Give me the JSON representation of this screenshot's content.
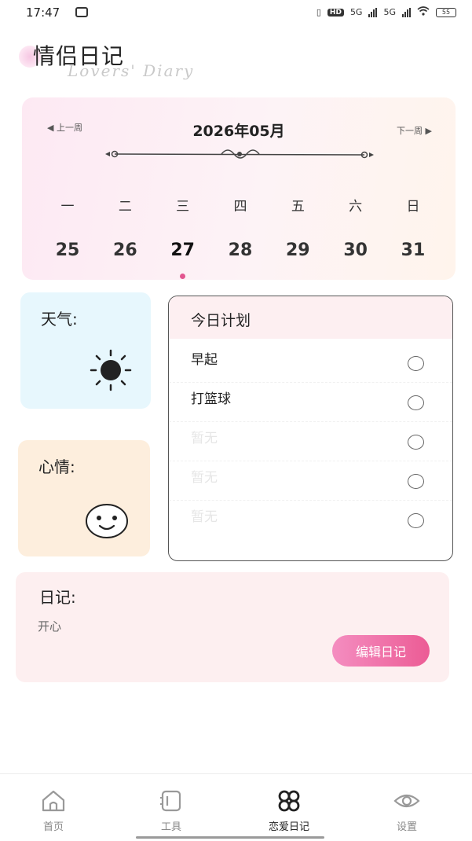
{
  "status_bar": {
    "time": "17:47",
    "hd": "HD",
    "signal_1": "5G",
    "signal_2": "5G",
    "battery": "55"
  },
  "header": {
    "title": "情侣日记",
    "subtitle": "Lovers' Diary"
  },
  "calendar": {
    "prev_label": "◀ 上一周",
    "next_label": "下一周 ▶",
    "month": "2026年05月",
    "weekdays": [
      "一",
      "二",
      "三",
      "四",
      "五",
      "六",
      "日"
    ],
    "dates": [
      "25",
      "26",
      "27",
      "28",
      "29",
      "30",
      "31"
    ],
    "selected_date": "27"
  },
  "weather": {
    "label": "天气:",
    "icon": "sun-icon"
  },
  "mood": {
    "label": "心情:",
    "icon": "smiley-icon"
  },
  "plan": {
    "title": "今日计划",
    "items": [
      {
        "text": "早起",
        "checked": false
      },
      {
        "text": "打篮球",
        "checked": false
      },
      {
        "text": "暂无",
        "checked": false
      },
      {
        "text": "暂无",
        "checked": false
      },
      {
        "text": "暂无",
        "checked": false
      }
    ]
  },
  "diary": {
    "label": "日记:",
    "content": "开心",
    "edit_button": "编辑日记"
  },
  "tabs": [
    {
      "label": "首页",
      "icon": "home-icon",
      "active": false
    },
    {
      "label": "工具",
      "icon": "tool-icon",
      "active": false
    },
    {
      "label": "恋爱日记",
      "icon": "grid-icon",
      "active": true
    },
    {
      "label": "设置",
      "icon": "eye-icon",
      "active": false
    }
  ],
  "colors": {
    "accent": "#ec5c95",
    "weather_bg": "#e7f7fd",
    "mood_bg": "#fdeedd",
    "diary_bg": "#fdeff0"
  }
}
